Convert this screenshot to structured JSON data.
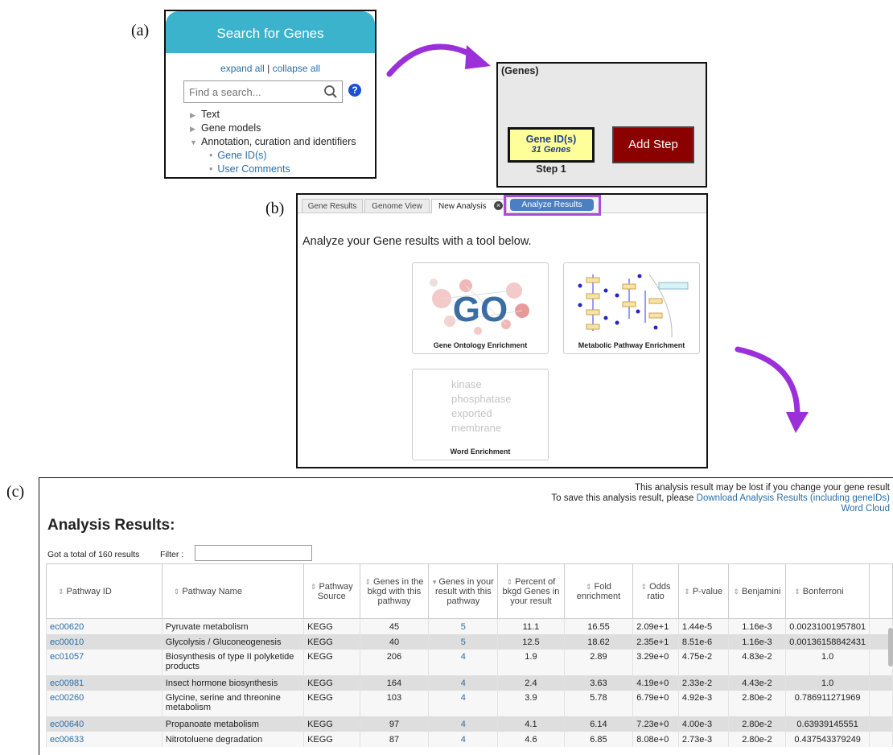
{
  "labels": {
    "a": "(a)",
    "b": "(b)",
    "c": "(c)"
  },
  "search": {
    "header": "Search for Genes",
    "expand_all": "expand all",
    "separator": " | ",
    "collapse_all": "collapse all",
    "placeholder": "Find a search...",
    "tree": [
      {
        "label": "Text",
        "state": "collapsed"
      },
      {
        "label": "Gene models",
        "state": "collapsed"
      },
      {
        "label": "Annotation, curation and identifiers",
        "state": "expanded"
      }
    ],
    "subitems": [
      "Gene ID(s)",
      "User Comments"
    ]
  },
  "strategy": {
    "title": "(Genes)",
    "step_name": "Gene ID(s)",
    "step_count": "31 Genes",
    "step_label": "Step 1",
    "add_step": "Add Step"
  },
  "analysis": {
    "tabs": [
      "Gene Results",
      "Genome View",
      "New Analysis"
    ],
    "analyze_button": "Analyze Results",
    "heading": "Analyze your Gene results with a tool below.",
    "cards": [
      "Gene Ontology Enrichment",
      "Metabolic Pathway Enrichment",
      "Word Enrichment"
    ],
    "go_logo": "GO",
    "word_cloud": [
      "kinase",
      "phosphatase",
      "exported",
      "membrane"
    ]
  },
  "results": {
    "notice_line1": "This analysis result may be lost if you change your gene result",
    "notice_line2_text": "To save this analysis result, please ",
    "notice_line2_link": "Download Analysis Results (including geneIDs)",
    "notice_line3_link": "Word Cloud",
    "title": "Analysis Results:",
    "total": "Got a total of 160 results",
    "filter_label": "Filter :",
    "columns": [
      "Pathway ID",
      "Pathway Name",
      "Pathway Source",
      "Genes in the bkgd with this pathway",
      "Genes in your result with this pathway",
      "Percent of bkgd Genes in your result",
      "Fold enrichment",
      "Odds ratio",
      "P-value",
      "Benjamini",
      "Bonferroni"
    ],
    "rows": [
      [
        "ec00620",
        "Pyruvate metabolism",
        "KEGG",
        "45",
        "5",
        "11.1",
        "16.55",
        "2.09e+1",
        "1.44e-5",
        "1.16e-3",
        "0.00231001957801"
      ],
      [
        "ec00010",
        "Glycolysis / Gluconeogenesis",
        "KEGG",
        "40",
        "5",
        "12.5",
        "18.62",
        "2.35e+1",
        "8.51e-6",
        "1.16e-3",
        "0.00136158842431"
      ],
      [
        "ec01057",
        "Biosynthesis of type II polyketide products",
        "KEGG",
        "206",
        "4",
        "1.9",
        "2.89",
        "3.29e+0",
        "4.75e-2",
        "4.83e-2",
        "1.0"
      ],
      [
        "ec00981",
        "Insect hormone biosynthesis",
        "KEGG",
        "164",
        "4",
        "2.4",
        "3.63",
        "4.19e+0",
        "2.33e-2",
        "4.43e-2",
        "1.0"
      ],
      [
        "ec00260",
        "Glycine, serine and threonine metabolism",
        "KEGG",
        "103",
        "4",
        "3.9",
        "5.78",
        "6.79e+0",
        "4.92e-3",
        "2.80e-2",
        "0.786911271969"
      ],
      [
        "ec00640",
        "Propanoate metabolism",
        "KEGG",
        "97",
        "4",
        "4.1",
        "6.14",
        "7.23e+0",
        "4.00e-3",
        "2.80e-2",
        "0.63939145551"
      ],
      [
        "ec00633",
        "Nitrotoluene degradation",
        "KEGG",
        "87",
        "4",
        "4.6",
        "6.85",
        "8.08e+0",
        "2.73e-3",
        "2.80e-2",
        "0.437543379249"
      ]
    ]
  },
  "colors": {
    "header_teal": "#3bb3cc",
    "add_step_red": "#8b0000",
    "step_yellow": "#ffff99",
    "highlight_purple": "#a64dd9",
    "arrow_purple": "#9b30d9",
    "link_blue": "#2a6ea8"
  },
  "icons": [
    "search-icon",
    "help-icon",
    "close-icon",
    "curved-arrow-icon",
    "sort-icon"
  ]
}
